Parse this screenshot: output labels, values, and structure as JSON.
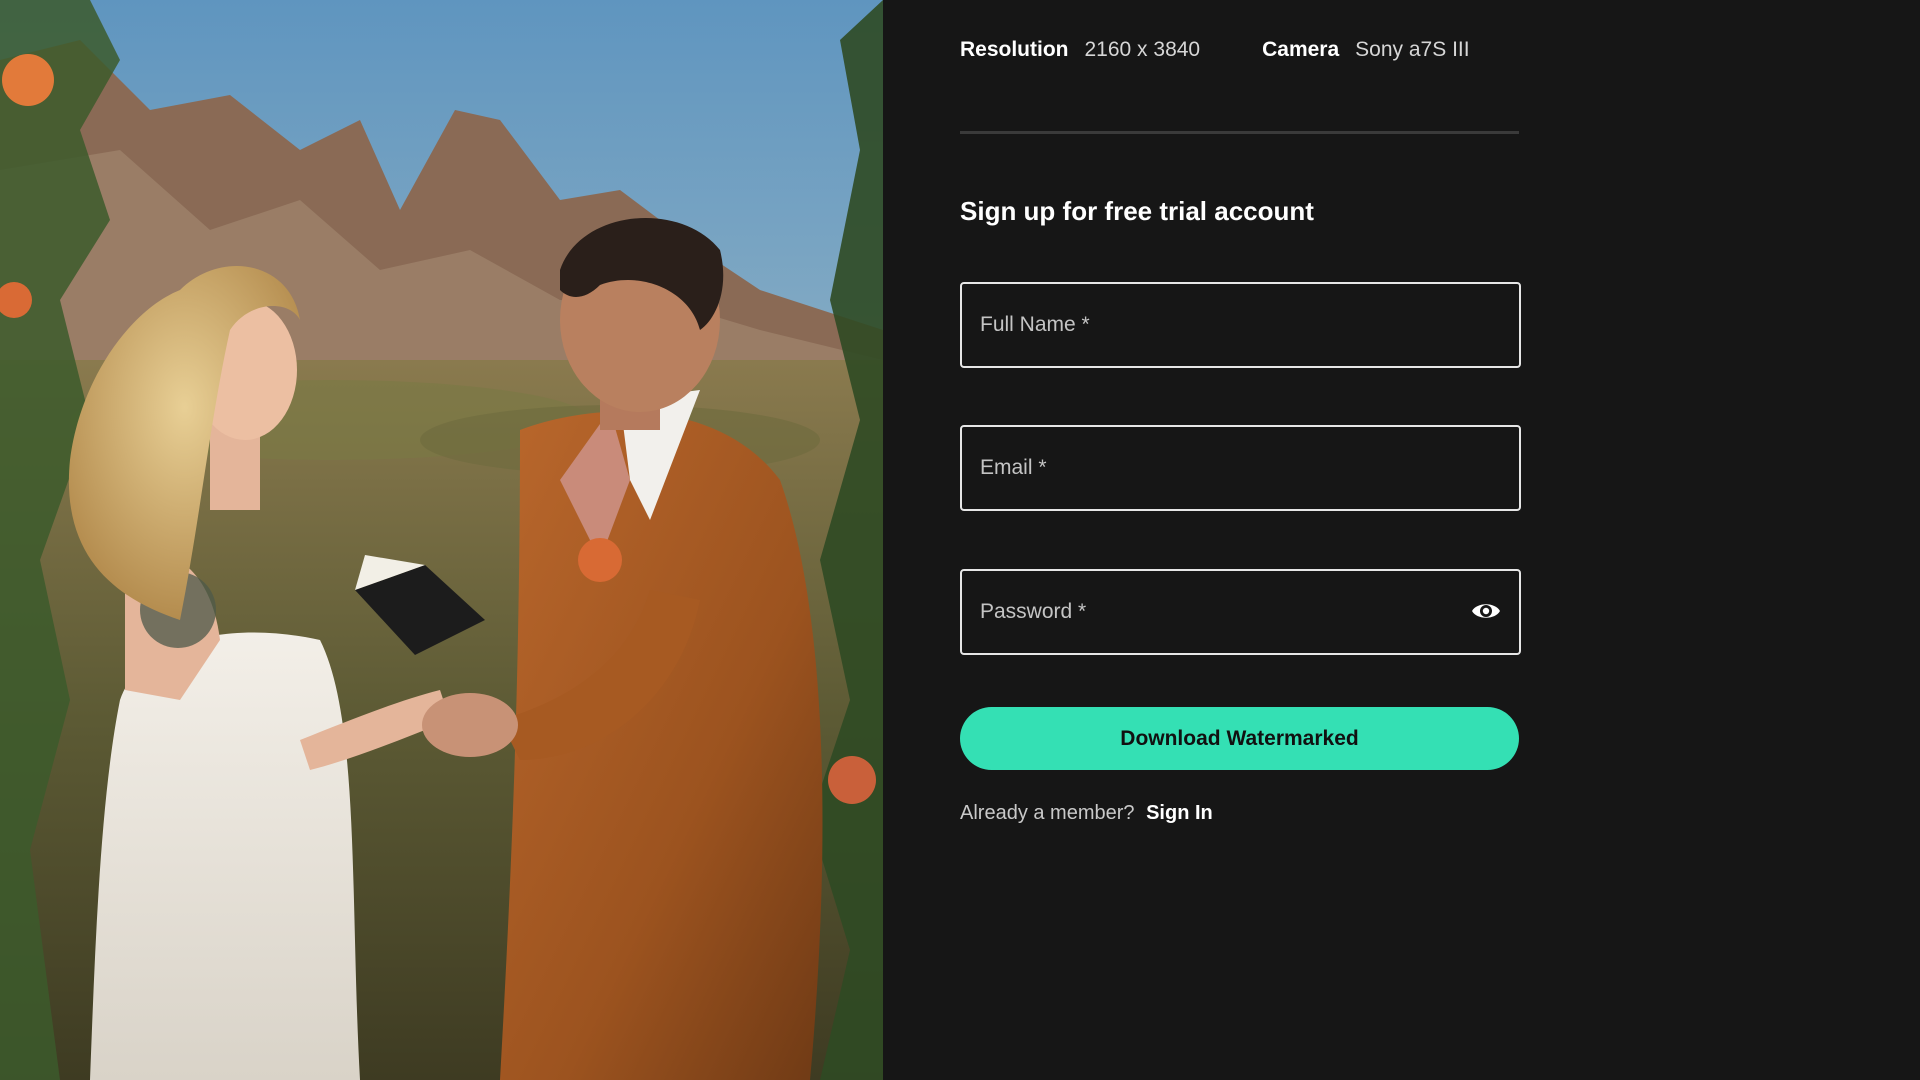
{
  "meta": {
    "resolution_label": "Resolution",
    "resolution_value": "2160 x 3840",
    "camera_label": "Camera",
    "camera_value": "Sony a7S III"
  },
  "form": {
    "title": "Sign up for free trial account",
    "full_name_placeholder": "Full Name *",
    "email_placeholder": "Email *",
    "password_placeholder": "Password *",
    "password_toggle_icon": "eye-icon",
    "submit_label": "Download Watermarked",
    "signin_prompt": "Already a member?",
    "signin_link": "Sign In"
  },
  "colors": {
    "background": "#161616",
    "accent": "#34e0b4",
    "field_border": "#e6e6e6"
  }
}
